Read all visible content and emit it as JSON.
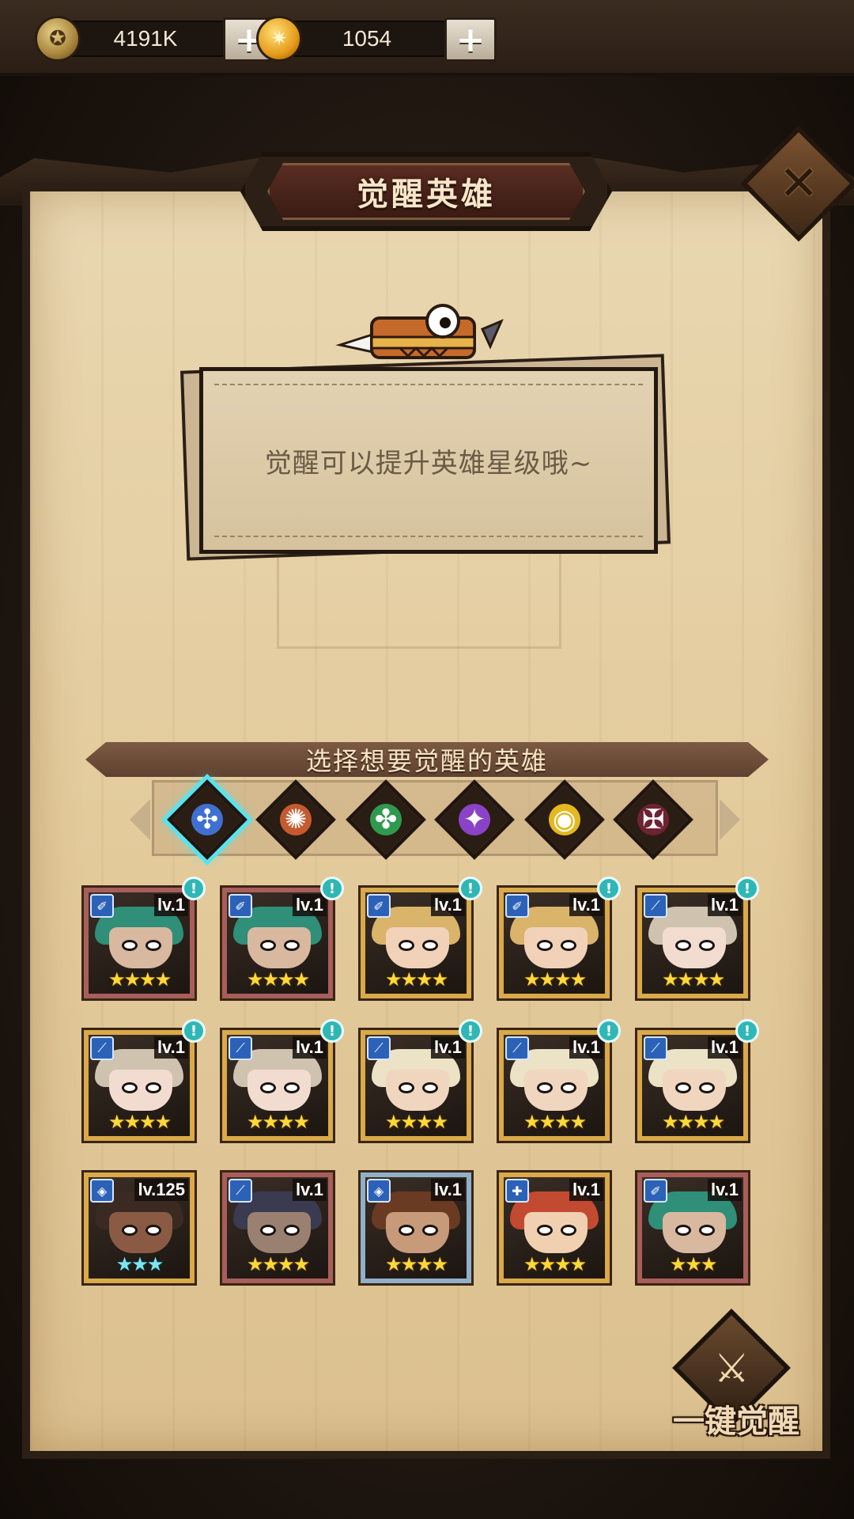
{
  "resources": {
    "gold": {
      "value": "4191K",
      "icon": "gold-coin-icon"
    },
    "gems": {
      "value": "1054",
      "icon": "gem-orb-icon"
    }
  },
  "panel": {
    "title": "觉醒英雄",
    "tip": "觉醒可以提升英雄星级哦~",
    "select_prompt": "选择想要觉醒的英雄",
    "one_key_awaken": "一键觉醒"
  },
  "element_tabs": [
    {
      "id": "ice",
      "icon": "ice-element-icon",
      "color": "#3f6fd0",
      "glyph": "✣",
      "active": true
    },
    {
      "id": "fire",
      "icon": "fire-element-icon",
      "color": "#c55a2e",
      "glyph": "✺",
      "active": false
    },
    {
      "id": "nature",
      "icon": "nature-element-icon",
      "color": "#2f9a4e",
      "glyph": "✤",
      "active": false
    },
    {
      "id": "arcane",
      "icon": "arcane-element-icon",
      "color": "#8a43c6",
      "glyph": "✦",
      "active": false
    },
    {
      "id": "light",
      "icon": "light-element-icon",
      "color": "#e4b81e",
      "glyph": "◉",
      "active": false
    },
    {
      "id": "dark",
      "icon": "dark-element-icon",
      "color": "#6e2232",
      "glyph": "✠",
      "active": false
    }
  ],
  "heroes": [
    {
      "level": "lv.1",
      "stars": "★★★★",
      "cls": "✐",
      "hair": "#2f8f78",
      "skin": "#d9b8a0",
      "frame": "red",
      "alert": "!"
    },
    {
      "level": "lv.1",
      "stars": "★★★★",
      "cls": "✐",
      "hair": "#2f8f78",
      "skin": "#d9b8a0",
      "frame": "red",
      "alert": "!"
    },
    {
      "level": "lv.1",
      "stars": "★★★★",
      "cls": "✐",
      "hair": "#d9b46a",
      "skin": "#f1d2b8",
      "frame": "gold",
      "alert": "!"
    },
    {
      "level": "lv.1",
      "stars": "★★★★",
      "cls": "✐",
      "hair": "#d9b46a",
      "skin": "#f1d2b8",
      "frame": "gold",
      "alert": "!"
    },
    {
      "level": "lv.1",
      "stars": "★★★★",
      "cls": "⟋",
      "hair": "#cfc3b0",
      "skin": "#f2dcd0",
      "frame": "gold",
      "alert": "!"
    },
    {
      "level": "lv.1",
      "stars": "★★★★",
      "cls": "⟋",
      "hair": "#cfc3b0",
      "skin": "#f2dcd0",
      "frame": "gold",
      "alert": "!"
    },
    {
      "level": "lv.1",
      "stars": "★★★★",
      "cls": "⟋",
      "hair": "#cfc3b0",
      "skin": "#f2dcd0",
      "frame": "gold",
      "alert": "!"
    },
    {
      "level": "lv.1",
      "stars": "★★★★",
      "cls": "⟋",
      "hair": "#ece2c6",
      "skin": "#f0d6bf",
      "frame": "gold",
      "alert": "!"
    },
    {
      "level": "lv.1",
      "stars": "★★★★",
      "cls": "⟋",
      "hair": "#ece2c6",
      "skin": "#f0d6bf",
      "frame": "gold",
      "alert": "!"
    },
    {
      "level": "lv.1",
      "stars": "★★★★",
      "cls": "⟋",
      "hair": "#ece2c6",
      "skin": "#f0d6bf",
      "frame": "gold",
      "alert": "!"
    },
    {
      "level": "lv.125",
      "stars": "★★★",
      "cls": "◈",
      "hair": "#3a2a22",
      "skin": "#8a5a45",
      "frame": "gold",
      "alert": "",
      "cyan": true
    },
    {
      "level": "lv.1",
      "stars": "★★★★",
      "cls": "⟋",
      "hair": "#3a3a50",
      "skin": "#9a8070",
      "frame": "red",
      "alert": ""
    },
    {
      "level": "lv.1",
      "stars": "★★★★",
      "cls": "◈",
      "hair": "#6a3a22",
      "skin": "#c79a7a",
      "frame": "blue",
      "alert": ""
    },
    {
      "level": "lv.1",
      "stars": "★★★★",
      "cls": "✚",
      "hair": "#c24a30",
      "skin": "#f0d0b0",
      "frame": "gold",
      "alert": ""
    },
    {
      "level": "lv.1",
      "stars": "★★★",
      "cls": "✐",
      "hair": "#2f8f78",
      "skin": "#d9b8a0",
      "frame": "red",
      "alert": ""
    }
  ]
}
